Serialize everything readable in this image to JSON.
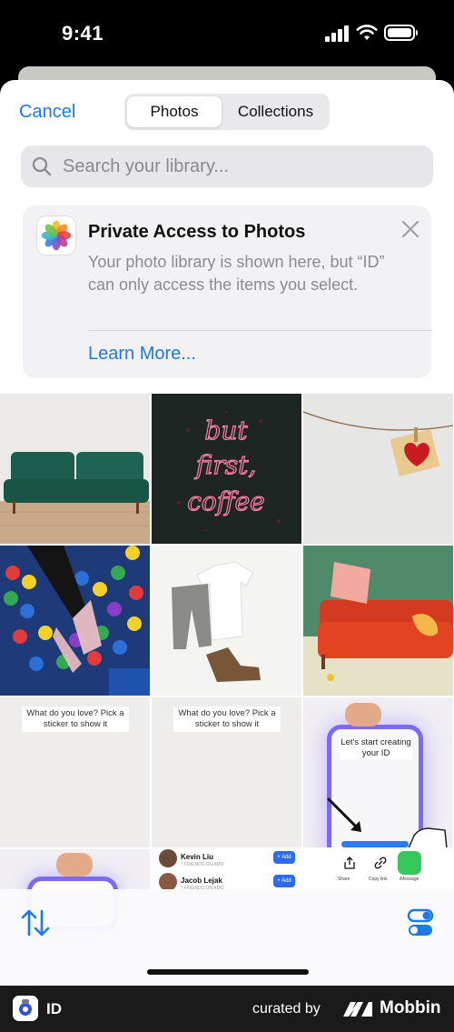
{
  "status_bar": {
    "time": "9:41"
  },
  "header": {
    "cancel_label": "Cancel",
    "tabs": [
      {
        "label": "Photos",
        "selected": true
      },
      {
        "label": "Collections",
        "selected": false
      }
    ]
  },
  "search": {
    "placeholder": "Search your library..."
  },
  "notice": {
    "title": "Private Access to Photos",
    "body": "Your photo library is shown here, but “ID” can only access the items you select.",
    "link_label": "Learn More..."
  },
  "grid": {
    "tiles": [
      {
        "subject": "green-sofa"
      },
      {
        "subject": "neon-sign",
        "text_lines": [
          "but",
          "first,",
          "coffee"
        ]
      },
      {
        "subject": "heart-clothespin"
      },
      {
        "subject": "ball-pit-boots"
      },
      {
        "subject": "clothes-flatlay"
      },
      {
        "subject": "red-sofa"
      },
      {
        "subject": "screenshot-sticker",
        "caption": "What do you love? Pick a sticker to show it"
      },
      {
        "subject": "screenshot-sticker",
        "caption": "What do you love? Pick a sticker to show it"
      },
      {
        "subject": "screenshot-phone",
        "caption": "Let's start creating your ID"
      },
      {
        "subject": "screenshot-hand"
      },
      {
        "subject": "screenshot-friends",
        "rows": [
          {
            "name": "Kevin Liu",
            "sub": "7 FRIENDS ON AMO",
            "button": "+ Add"
          },
          {
            "name": "Jacob Lejak",
            "sub": "7 FRIENDS ON AMO",
            "button": "+ Add"
          }
        ]
      },
      {
        "subject": "screenshot-share",
        "actions": [
          "Share",
          "Copy link",
          "iMessage"
        ]
      }
    ]
  },
  "footer": {
    "app_name": "ID",
    "curated_by": "curated by",
    "brand": "Mobbin"
  },
  "colors": {
    "accent": "#1b7ae5",
    "sheet": "#ffffff",
    "card": "#f2f2f5"
  }
}
